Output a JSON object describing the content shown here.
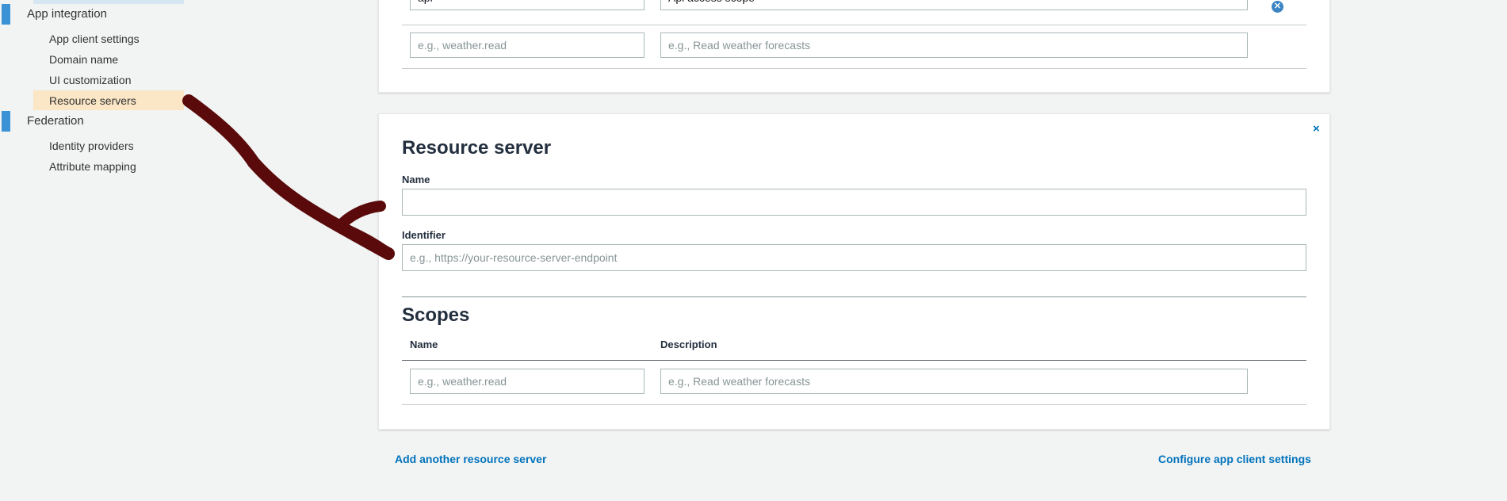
{
  "sidebar": {
    "groups": [
      {
        "label": "App integration",
        "items": [
          {
            "label": "App client settings"
          },
          {
            "label": "Domain name"
          },
          {
            "label": "UI customization"
          },
          {
            "label": "Resource servers",
            "active": true
          }
        ]
      },
      {
        "label": "Federation",
        "items": [
          {
            "label": "Identity providers"
          },
          {
            "label": "Attribute mapping"
          }
        ]
      }
    ]
  },
  "first_server": {
    "scopes": [
      {
        "name": "api",
        "description": "Api access scope"
      },
      {
        "name_placeholder": "e.g., weather.read",
        "description_placeholder": "e.g., Read weather forecasts"
      }
    ]
  },
  "resource_server": {
    "close_label": "×",
    "title": "Resource server",
    "name_label": "Name",
    "name_value": "",
    "identifier_label": "Identifier",
    "identifier_placeholder": "e.g., https://your-resource-server-endpoint",
    "scopes_title": "Scopes",
    "col_name": "Name",
    "col_description": "Description",
    "scope_row": {
      "name_placeholder": "e.g., weather.read",
      "description_placeholder": "e.g., Read weather forecasts"
    }
  },
  "footer": {
    "add_link": "Add another resource server",
    "configure_link": "Configure app client settings"
  },
  "colors": {
    "accent": "#0073bb",
    "active_bg": "#fbe6c6",
    "annotation_stroke": "#5a0a0a"
  },
  "icons": {
    "remove_scope": "circle-x-icon",
    "close_panel": "close-icon"
  }
}
